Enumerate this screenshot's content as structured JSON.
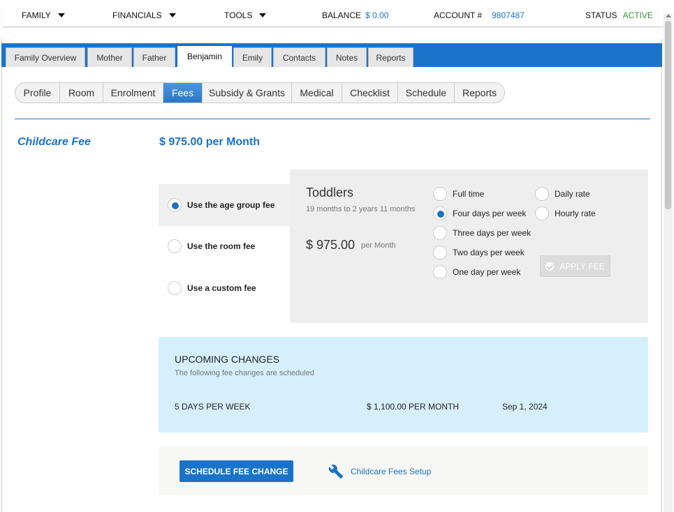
{
  "topbar": {
    "family": "FAMILY",
    "financials": "FINANCIALS",
    "tools": "TOOLS",
    "balance_label": "BALANCE",
    "balance_value": "$ 0.00",
    "account_label": "ACCOUNT #",
    "account_value": "9807487",
    "status_label": "STATUS",
    "status_value": "ACTIVE"
  },
  "tabs": [
    "Family Overview",
    "Mother",
    "Father",
    "Benjamin",
    "Emily",
    "Contacts",
    "Notes",
    "Reports"
  ],
  "active_tab": "Benjamin",
  "subnav": [
    "Profile",
    "Room",
    "Enrolment",
    "Fees",
    "Subsidy & Grants",
    "Medical",
    "Checklist",
    "Schedule",
    "Reports"
  ],
  "active_subnav": "Fees",
  "fee": {
    "label": "Childcare Fee",
    "amount": "$ 975.00 per Month"
  },
  "fee_options": [
    {
      "label": "Use the age group fee",
      "selected": true
    },
    {
      "label": "Use the room fee",
      "selected": false
    },
    {
      "label": "Use a custom fee",
      "selected": false
    }
  ],
  "age_group": {
    "title": "Toddlers",
    "range": "19 months to 2 years 11 months",
    "price": "$ 975.00",
    "per": "per Month"
  },
  "schedules_left": [
    {
      "label": "Full time",
      "selected": false
    },
    {
      "label": "Four days per week",
      "selected": true
    },
    {
      "label": "Three days per week",
      "selected": false
    },
    {
      "label": "Two days per week",
      "selected": false
    },
    {
      "label": "One day per week",
      "selected": false
    }
  ],
  "schedules_right": [
    {
      "label": "Daily rate",
      "selected": false
    },
    {
      "label": "Hourly rate",
      "selected": false
    }
  ],
  "apply_label": "APPLY FEE",
  "upcoming": {
    "title": "UPCOMING CHANGES",
    "subtitle": "The following fee changes are scheduled",
    "rows": [
      {
        "schedule": "5 DAYS PER WEEK",
        "amount": "$ 1,100.00 PER MONTH",
        "date": "Sep 1, 2024"
      }
    ]
  },
  "footer": {
    "schedule_button": "SCHEDULE FEE CHANGE",
    "setup_link": "Childcare Fees Setup"
  },
  "colors": {
    "accent": "#1a73c7",
    "upcoming_bg": "#d6effc",
    "status_green": "#3b8a3b"
  }
}
